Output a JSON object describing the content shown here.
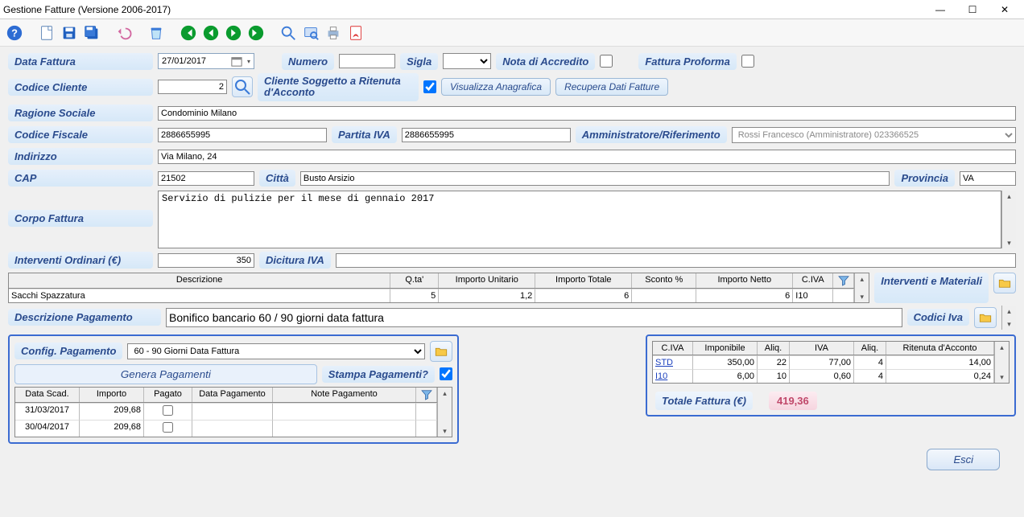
{
  "window": {
    "title": "Gestione Fatture (Versione 2006-2017)"
  },
  "labels": {
    "data_fattura": "Data Fattura",
    "numero": "Numero",
    "sigla": "Sigla",
    "nota_accredito": "Nota di Accredito",
    "fattura_proforma": "Fattura Proforma",
    "codice_cliente": "Codice Cliente",
    "cliente_ritenuta": "Cliente Soggetto a Ritenuta d'Acconto",
    "visualizza_anagrafica": "Visualizza Anagrafica",
    "recupera_dati": "Recupera Dati Fatture",
    "ragione_sociale": "Ragione Sociale",
    "codice_fiscale": "Codice Fiscale",
    "partita_iva": "Partita IVA",
    "amministratore": "Amministratore/Riferimento",
    "indirizzo": "Indirizzo",
    "cap": "CAP",
    "citta": "Città",
    "provincia": "Provincia",
    "corpo_fattura": "Corpo Fattura",
    "interventi_ordinari": "Interventi Ordinari (€)",
    "dicitura_iva": "Dicitura IVA",
    "interventi_materiali": "Interventi e Materiali",
    "descrizione_pagamento": "Descrizione Pagamento",
    "codici_iva": "Codici Iva",
    "config_pagamento": "Config. Pagamento",
    "genera_pagamenti": "Genera Pagamenti",
    "stampa_pagamenti": "Stampa Pagamenti?",
    "totale_fattura": "Totale Fattura (€)",
    "esci": "Esci"
  },
  "header": {
    "data": "27/01/2017",
    "numero": "",
    "sigla": "",
    "codice_cliente": "2",
    "ritenuta_checked": true,
    "ragione_sociale": "Condominio Milano",
    "codice_fiscale": "2886655995",
    "partita_iva": "2886655995",
    "amministratore": "Rossi Francesco (Amministratore) 023366525",
    "indirizzo": "Via Milano, 24",
    "cap": "21502",
    "citta": "Busto Arsizio",
    "provincia": "VA",
    "corpo": "Servizio di pulizie per il mese di gennaio 2017",
    "interventi_ordinari": "350",
    "dicitura_iva": ""
  },
  "lines_headers": {
    "descrizione": "Descrizione",
    "qta": "Q.ta'",
    "importo_unitario": "Importo Unitario",
    "importo_totale": "Importo Totale",
    "sconto": "Sconto %",
    "importo_netto": "Importo Netto",
    "civa": "C.IVA"
  },
  "lines": [
    {
      "descrizione": "Sacchi Spazzatura",
      "qta": "5",
      "importo_unitario": "1,2",
      "importo_totale": "6",
      "sconto": "",
      "importo_netto": "6",
      "civa": "I10"
    }
  ],
  "pagamento": {
    "descrizione": "Bonifico bancario 60 / 90 giorni data fattura",
    "config_selected": "60 - 90 Giorni Data Fattura",
    "stampa_checked": true,
    "headers": {
      "data_scad": "Data Scad.",
      "importo": "Importo",
      "pagato": "Pagato",
      "data_pag": "Data Pagamento",
      "note": "Note Pagamento"
    },
    "rows": [
      {
        "data_scad": "31/03/2017",
        "importo": "209,68",
        "pagato": false,
        "data_pag": "",
        "note": ""
      },
      {
        "data_scad": "30/04/2017",
        "importo": "209,68",
        "pagato": false,
        "data_pag": "",
        "note": ""
      }
    ]
  },
  "vat": {
    "headers": {
      "civa": "C.IVA",
      "imponibile": "Imponibile",
      "aliq": "Aliq.",
      "iva": "IVA",
      "aliq2": "Aliq.",
      "ritenuta": "Ritenuta d'Acconto"
    },
    "rows": [
      {
        "civa": "STD",
        "imponibile": "350,00",
        "aliq": "22",
        "iva": "77,00",
        "aliq2": "4",
        "ritenuta": "14,00"
      },
      {
        "civa": "I10",
        "imponibile": "6,00",
        "aliq": "10",
        "iva": "0,60",
        "aliq2": "4",
        "ritenuta": "0,24"
      }
    ],
    "totale": "419,36"
  }
}
